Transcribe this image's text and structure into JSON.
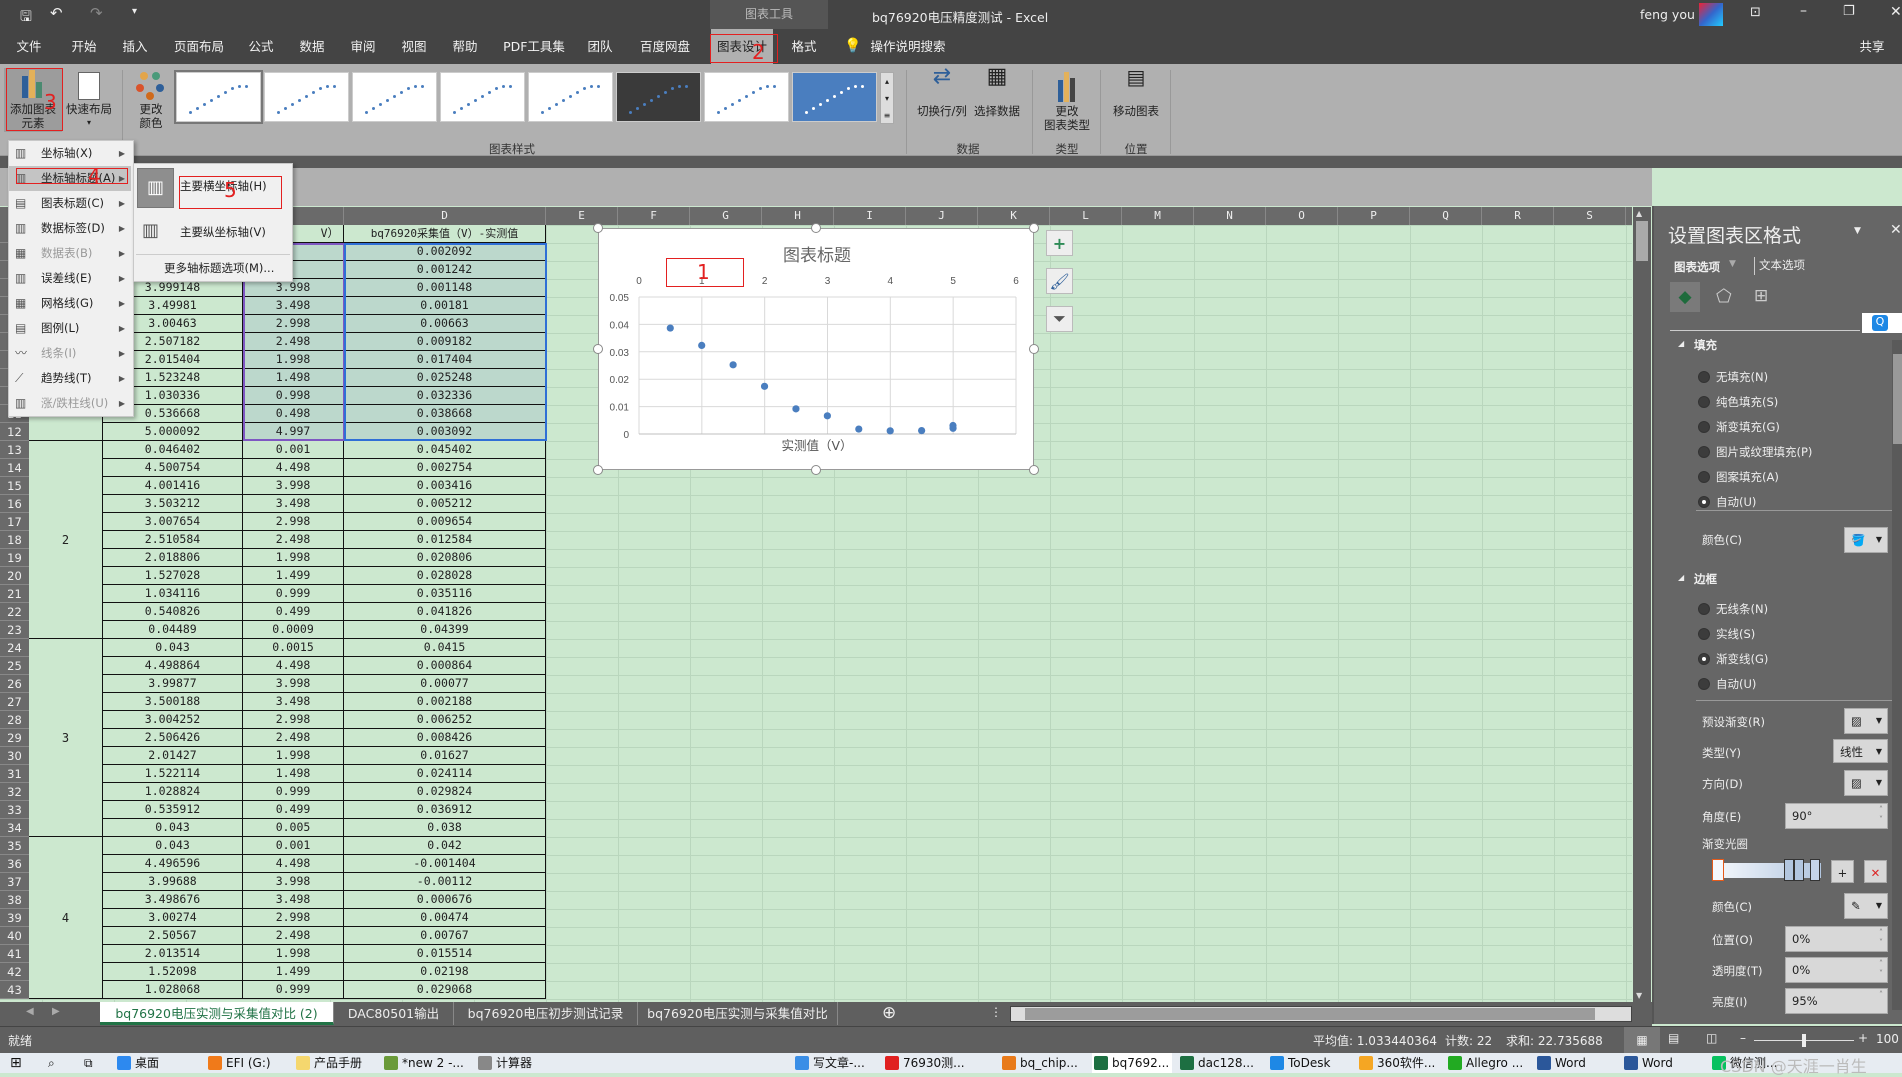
{
  "title_bar": {
    "context_tab": "图表工具",
    "doc_title": "bq76920电压精度测试  -  Excel",
    "user": "feng you"
  },
  "ribbon_tabs": [
    "文件",
    "开始",
    "插入",
    "页面布局",
    "公式",
    "数据",
    "审阅",
    "视图",
    "帮助",
    "PDF工具集",
    "团队",
    "百度网盘",
    "图表设计",
    "格式"
  ],
  "active_tab": "图表设计",
  "search_label": "操作说明搜索",
  "share_label": "共享",
  "ribbon": {
    "add_element_1": "添加图表",
    "add_element_2": "元素",
    "quick_layout": "快速布局",
    "change_colors_1": "更改",
    "change_colors_2": "颜色",
    "styles_group": "图表样式",
    "switch_row_col": "切换行/列",
    "select_data": "选择数据",
    "data_group": "数据",
    "change_type_1": "更改",
    "change_type_2": "图表类型",
    "type_group": "类型",
    "move_chart": "移动图表",
    "location_group": "位置"
  },
  "annotations": {
    "a1": "1",
    "a2": "2",
    "a3": "3",
    "a4": "4",
    "a5": "5"
  },
  "add_element_menu": [
    {
      "label": "坐标轴(X)",
      "icon": "axes-icon",
      "enabled": true
    },
    {
      "label": "坐标轴标题(A)",
      "icon": "axis-title-icon",
      "enabled": true,
      "highlighted": true
    },
    {
      "label": "图表标题(C)",
      "icon": "chart-title-icon",
      "enabled": true
    },
    {
      "label": "数据标签(D)",
      "icon": "data-labels-icon",
      "enabled": true
    },
    {
      "label": "数据表(B)",
      "icon": "data-table-icon",
      "enabled": false
    },
    {
      "label": "误差线(E)",
      "icon": "error-bars-icon",
      "enabled": true
    },
    {
      "label": "网格线(G)",
      "icon": "gridlines-icon",
      "enabled": true
    },
    {
      "label": "图例(L)",
      "icon": "legend-icon",
      "enabled": true
    },
    {
      "label": "线条(I)",
      "icon": "lines-icon",
      "enabled": false
    },
    {
      "label": "趋势线(T)",
      "icon": "trendline-icon",
      "enabled": true
    },
    {
      "label": "涨/跌柱线(U)",
      "icon": "up-down-bars-icon",
      "enabled": false
    }
  ],
  "axis_title_submenu": {
    "primary_horizontal": "主要横坐标轴(H)",
    "primary_vertical": "主要纵坐标轴(V)",
    "more_options": "更多轴标题选项(M)..."
  },
  "columns": [
    "D",
    "E",
    "F",
    "G",
    "H",
    "I",
    "J",
    "K",
    "L",
    "M",
    "N",
    "O",
    "P",
    "Q",
    "R",
    "S"
  ],
  "sheet": {
    "header_row": {
      "n": 1,
      "c": "V）",
      "d": "bq76920采集值（V）-实测值"
    },
    "rows": [
      {
        "n": 2,
        "b": "",
        "c": "",
        "d": "0.002092"
      },
      {
        "n": 3,
        "b": "",
        "c": "",
        "d": "0.001242"
      },
      {
        "n": 4,
        "b": "3.999148",
        "c": "3.998",
        "d": "0.001148"
      },
      {
        "n": 5,
        "b": "3.49981",
        "c": "3.498",
        "d": "0.00181"
      },
      {
        "n": 6,
        "b": "3.00463",
        "c": "2.998",
        "d": "0.00663"
      },
      {
        "n": 7,
        "b": "2.507182",
        "c": "2.498",
        "d": "0.009182"
      },
      {
        "n": 8,
        "b": "2.015404",
        "c": "1.998",
        "d": "0.017404"
      },
      {
        "n": 9,
        "b": "1.523248",
        "c": "1.498",
        "d": "0.025248"
      },
      {
        "n": 10,
        "b": "1.030336",
        "c": "0.998",
        "d": "0.032336"
      },
      {
        "n": 11,
        "b": "0.536668",
        "c": "0.498",
        "d": "0.038668"
      },
      {
        "n": 12,
        "b": "5.000092",
        "c": "4.997",
        "d": "0.003092"
      },
      {
        "n": 13,
        "b": "0.046402",
        "c": "0.001",
        "d": "0.045402"
      },
      {
        "n": 14,
        "b": "4.500754",
        "c": "4.498",
        "d": "0.002754"
      },
      {
        "n": 15,
        "b": "4.001416",
        "c": "3.998",
        "d": "0.003416"
      },
      {
        "n": 16,
        "b": "3.503212",
        "c": "3.498",
        "d": "0.005212"
      },
      {
        "n": 17,
        "b": "3.007654",
        "c": "2.998",
        "d": "0.009654"
      },
      {
        "n": 18,
        "b": "2.510584",
        "c": "2.498",
        "d": "0.012584"
      },
      {
        "n": 19,
        "b": "2.018806",
        "c": "1.998",
        "d": "0.020806"
      },
      {
        "n": 20,
        "b": "1.527028",
        "c": "1.499",
        "d": "0.028028"
      },
      {
        "n": 21,
        "b": "1.034116",
        "c": "0.999",
        "d": "0.035116"
      },
      {
        "n": 22,
        "b": "0.540826",
        "c": "0.499",
        "d": "0.041826"
      },
      {
        "n": 23,
        "b": "0.04489",
        "c": "0.0009",
        "d": "0.04399"
      },
      {
        "n": 24,
        "b": "0.043",
        "c": "0.0015",
        "d": "0.0415"
      },
      {
        "n": 25,
        "b": "4.498864",
        "c": "4.498",
        "d": "0.000864"
      },
      {
        "n": 26,
        "b": "3.99877",
        "c": "3.998",
        "d": "0.00077"
      },
      {
        "n": 27,
        "b": "3.500188",
        "c": "3.498",
        "d": "0.002188"
      },
      {
        "n": 28,
        "b": "3.004252",
        "c": "2.998",
        "d": "0.006252"
      },
      {
        "n": 29,
        "b": "2.506426",
        "c": "2.498",
        "d": "0.008426"
      },
      {
        "n": 30,
        "b": "2.01427",
        "c": "1.998",
        "d": "0.01627"
      },
      {
        "n": 31,
        "b": "1.522114",
        "c": "1.498",
        "d": "0.024114"
      },
      {
        "n": 32,
        "b": "1.028824",
        "c": "0.999",
        "d": "0.029824"
      },
      {
        "n": 33,
        "b": "0.535912",
        "c": "0.499",
        "d": "0.036912"
      },
      {
        "n": 34,
        "b": "0.043",
        "c": "0.005",
        "d": "0.038"
      },
      {
        "n": 35,
        "b": "0.043",
        "c": "0.001",
        "d": "0.042"
      },
      {
        "n": 36,
        "b": "4.496596",
        "c": "4.498",
        "d": "-0.001404"
      },
      {
        "n": 37,
        "b": "3.99688",
        "c": "3.998",
        "d": "-0.00112"
      },
      {
        "n": 38,
        "b": "3.498676",
        "c": "3.498",
        "d": "0.000676"
      },
      {
        "n": 39,
        "b": "3.00274",
        "c": "2.998",
        "d": "0.00474"
      },
      {
        "n": 40,
        "b": "2.50567",
        "c": "2.498",
        "d": "0.00767"
      },
      {
        "n": 41,
        "b": "2.013514",
        "c": "1.998",
        "d": "0.015514"
      },
      {
        "n": 42,
        "b": "1.52098",
        "c": "1.499",
        "d": "0.02198"
      },
      {
        "n": 43,
        "b": "1.028068",
        "c": "0.999",
        "d": "0.029068"
      }
    ],
    "groups": [
      {
        "label": "",
        "from": 2,
        "to": 12
      },
      {
        "label": "2",
        "from": 13,
        "to": 23
      },
      {
        "label": "3",
        "from": 24,
        "to": 34
      },
      {
        "label": "4",
        "from": 35,
        "to": 43
      }
    ]
  },
  "chart_data": {
    "type": "scatter",
    "title": "图表标题",
    "xlabel": "实测值（V）",
    "ylabel": "",
    "x_axis_position": "top",
    "xlim": [
      0,
      6
    ],
    "xticks": [
      "0",
      "1",
      "2",
      "3",
      "4",
      "5",
      "6"
    ],
    "ylim": [
      0,
      0.05
    ],
    "yticks": [
      "0",
      "0.01",
      "0.02",
      "0.03",
      "0.04",
      "0.05"
    ],
    "grid": true,
    "marker_color": "#4a7ebf",
    "x": [
      4.998,
      4.498,
      3.998,
      3.498,
      2.998,
      2.498,
      1.998,
      1.498,
      0.998,
      0.498,
      4.997
    ],
    "y": [
      0.002092,
      0.001242,
      0.001148,
      0.00181,
      0.00663,
      0.009182,
      0.017404,
      0.025248,
      0.032336,
      0.038668,
      0.003092
    ]
  },
  "format_pane": {
    "title": "设置图表区格式",
    "tab_chart": "图表选项",
    "tab_text": "文本选项",
    "fill_section": "填充",
    "fill_options": [
      {
        "label": "无填充(N)",
        "on": false
      },
      {
        "label": "纯色填充(S)",
        "on": false
      },
      {
        "label": "渐变填充(G)",
        "on": false
      },
      {
        "label": "图片或纹理填充(P)",
        "on": false
      },
      {
        "label": "图案填充(A)",
        "on": false
      },
      {
        "label": "自动(U)",
        "on": true
      }
    ],
    "fill_color": "颜色(C)",
    "border_section": "边框",
    "border_options": [
      {
        "label": "无线条(N)",
        "on": false
      },
      {
        "label": "实线(S)",
        "on": false
      },
      {
        "label": "渐变线(G)",
        "on": true
      },
      {
        "label": "自动(U)",
        "on": false
      }
    ],
    "preset_gradient": "预设渐变(R)",
    "type_label": "类型(Y)",
    "type_value": "线性",
    "direction": "方向(D)",
    "angle_label": "角度(E)",
    "angle_value": "90°",
    "gradient_stops": "渐变光圈",
    "stop_color": "颜色(C)",
    "position_label": "位置(O)",
    "position_value": "0%",
    "transparency_label": "透明度(T)",
    "transparency_value": "0%",
    "brightness_label": "亮度(I)",
    "brightness_value": "95%"
  },
  "sheet_tabs": [
    "bq76920电压实测与采集值对比 (2)",
    "DAC80501输出",
    "bq76920电压初步测试记录",
    "bq76920电压实测与采集值对比"
  ],
  "status": {
    "ready": "就绪",
    "average": "平均值: 1.033440364",
    "count": "计数: 22",
    "sum": "求和: 22.735688",
    "zoom": "100"
  },
  "taskbar": [
    "桌面",
    "EFI (G:)",
    "产品手册",
    "*new 2 -...",
    "计算器",
    "写文章-...",
    "76930测...",
    "bq_chip...",
    "bq7692...",
    "dac128...",
    "ToDesk",
    "360软件...",
    "Allegro ...",
    "Word",
    "Word",
    "微信测..."
  ],
  "watermark": "CSDN @天涯一肖生"
}
